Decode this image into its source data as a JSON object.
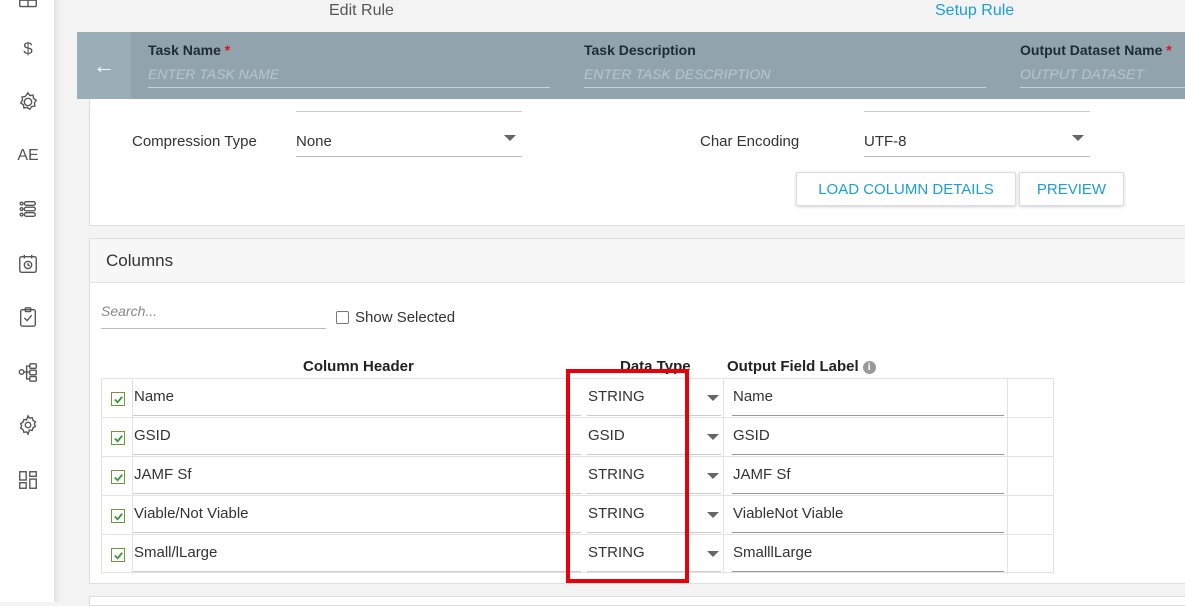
{
  "nav": {
    "edit_rule": "Edit Rule",
    "setup_rule": "Setup Rule"
  },
  "task": {
    "back_icon": "arrow-left-icon",
    "name_label": "Task Name",
    "name_placeholder": "ENTER TASK NAME",
    "desc_label": "Task Description",
    "desc_placeholder": "ENTER TASK DESCRIPTION",
    "output_label": "Output Dataset Name",
    "output_placeholder": "OUTPUT DATASET",
    "required_mark": "*"
  },
  "settings": {
    "compression_label": "Compression Type",
    "compression_value": "None",
    "encoding_label": "Char Encoding",
    "encoding_value": "UTF-8",
    "load_button": "LOAD COLUMN DETAILS",
    "preview_button": "PREVIEW"
  },
  "columns": {
    "title": "Columns",
    "search_placeholder": "Search...",
    "show_selected": "Show Selected",
    "headers": {
      "column_header": "Column Header",
      "data_type": "Data Type",
      "output_label": "Output Field Label"
    },
    "rows": [
      {
        "checked": true,
        "name": "Name",
        "type": "STRING",
        "label": "Name"
      },
      {
        "checked": true,
        "name": "GSID",
        "type": "GSID",
        "label": "GSID"
      },
      {
        "checked": true,
        "name": "JAMF Sf",
        "type": "STRING",
        "label": "JAMF Sf"
      },
      {
        "checked": true,
        "name": "Viable/Not Viable",
        "type": "STRING",
        "label": "ViableNot Viable"
      },
      {
        "checked": true,
        "name": "Small/lLarge",
        "type": "STRING",
        "label": "SmalllLarge"
      }
    ]
  },
  "sidebar_icons": [
    "grid-icon",
    "dollar-icon",
    "badge-gear-icon",
    "ae-icon",
    "list-icon",
    "calendar-clock-icon",
    "clipboard-check-icon",
    "flow-icon",
    "settings-icon",
    "dashboard-icon"
  ],
  "sidebar_ae_text": "AE",
  "sidebar_dollar_text": "$",
  "highlight_color": "#e8000b",
  "accent_color": "#1a9fd8"
}
